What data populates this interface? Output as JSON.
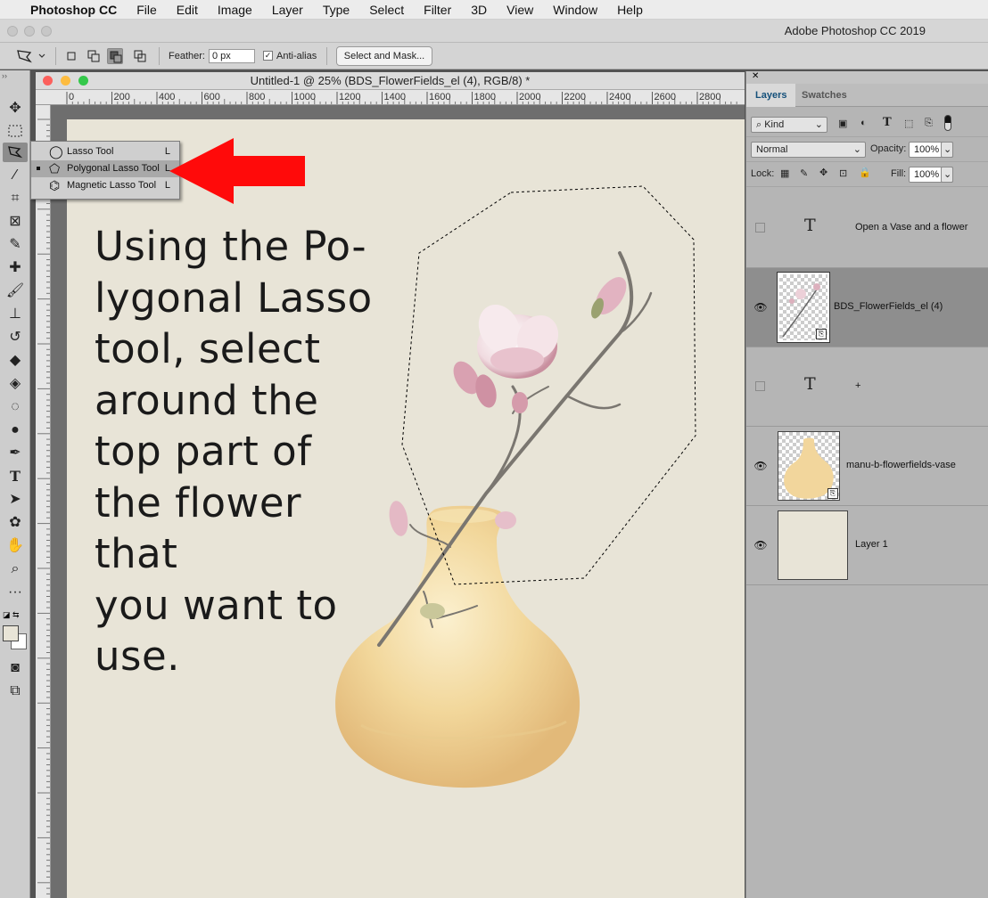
{
  "menubar": {
    "apple": "",
    "app": "Photoshop CC",
    "items": [
      "File",
      "Edit",
      "Image",
      "Layer",
      "Type",
      "Select",
      "Filter",
      "3D",
      "View",
      "Window",
      "Help"
    ]
  },
  "window": {
    "app_title": "Adobe Photoshop CC 2019"
  },
  "options": {
    "feather_label": "Feather:",
    "feather_value": "0 px",
    "antialias_label": "Anti-alias",
    "antialias_checked": true,
    "select_mask": "Select and Mask..."
  },
  "document": {
    "title": "Untitled-1 @ 25% (BDS_FlowerFields_el (4), RGB/8) *",
    "ruler_ticks": [
      "0",
      "200",
      "400",
      "600",
      "800",
      "1000",
      "1200",
      "1400",
      "1600",
      "1800",
      "2000",
      "2200",
      "2400",
      "2600",
      "2800"
    ]
  },
  "flyout": {
    "items": [
      {
        "label": "Lasso Tool",
        "key": "L",
        "active": false
      },
      {
        "label": "Polygonal Lasso Tool",
        "key": "L",
        "active": true
      },
      {
        "label": "Magnetic Lasso Tool",
        "key": "L",
        "active": false
      }
    ]
  },
  "instruction": "Using the Po-lygonal Lasso tool, select around the top part of the flower that you want to use.",
  "instruction_lines": [
    "Using the Po-",
    "lygonal Lasso",
    "tool, select",
    "around the",
    "top part of",
    "the flower that",
    "you want to",
    "use."
  ],
  "panel": {
    "tabs": [
      "Layers",
      "Swatches"
    ],
    "filter_label": "Kind",
    "blend_mode": "Normal",
    "opacity_label": "Opacity:",
    "opacity": "100%",
    "lock_label": "Lock:",
    "fill_label": "Fill:",
    "fill": "100%",
    "layers": [
      {
        "name": "Open a Vase and a flower",
        "kind": "text",
        "visible": false
      },
      {
        "name": "BDS_FlowerFields_el (4)",
        "kind": "smart",
        "visible": true,
        "selected": true
      },
      {
        "name": "+",
        "kind": "text",
        "visible": false
      },
      {
        "name": "manu-b-flowerfields-vase",
        "kind": "smart",
        "visible": true
      },
      {
        "name": "Layer 1",
        "kind": "fill",
        "visible": true
      }
    ]
  },
  "colors": {
    "canvas": "#e8e4d7",
    "arrow": "#ff0a0a",
    "selected_layer": "#8e8e8e",
    "tab_active_text": "#14507a"
  }
}
